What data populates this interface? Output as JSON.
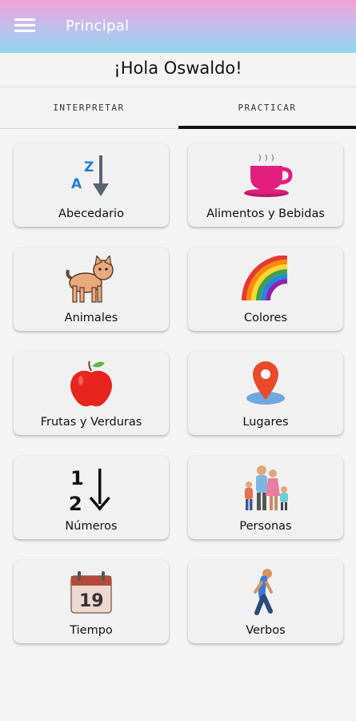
{
  "appbar": {
    "title": "Principal"
  },
  "greeting": "¡Hola Oswaldo!",
  "tabs": [
    {
      "label": "INTERPRETAR"
    },
    {
      "label": "PRACTICAR"
    }
  ],
  "active_tab": "PRACTICAR",
  "categories": [
    {
      "label": "Abecedario",
      "icon": "alphabet-sort-icon"
    },
    {
      "label": "Alimentos y Bebidas",
      "icon": "coffee-cup-icon"
    },
    {
      "label": "Animales",
      "icon": "cat-icon"
    },
    {
      "label": "Colores",
      "icon": "rainbow-icon"
    },
    {
      "label": "Frutas y Verduras",
      "icon": "apple-icon"
    },
    {
      "label": "Lugares",
      "icon": "location-pin-icon"
    },
    {
      "label": "Números",
      "icon": "number-sort-icon"
    },
    {
      "label": "Personas",
      "icon": "family-icon"
    },
    {
      "label": "Tiempo",
      "icon": "calendar-icon"
    },
    {
      "label": "Verbos",
      "icon": "walking-person-icon"
    }
  ],
  "icon_texts": {
    "alphabet": {
      "top": "Z",
      "bottom": "A"
    },
    "numbers": {
      "top": "1",
      "bottom": "2"
    },
    "calendar_day": "19"
  },
  "colors": {
    "appbar_gradient": [
      "#f1a2d3",
      "#c7bcec",
      "#8fd8ef"
    ],
    "accent_blue": "#1e7fd6",
    "cup_pink": "#e21f7d",
    "apple_red": "#e8241f",
    "pin_red": "#e94a2a"
  }
}
